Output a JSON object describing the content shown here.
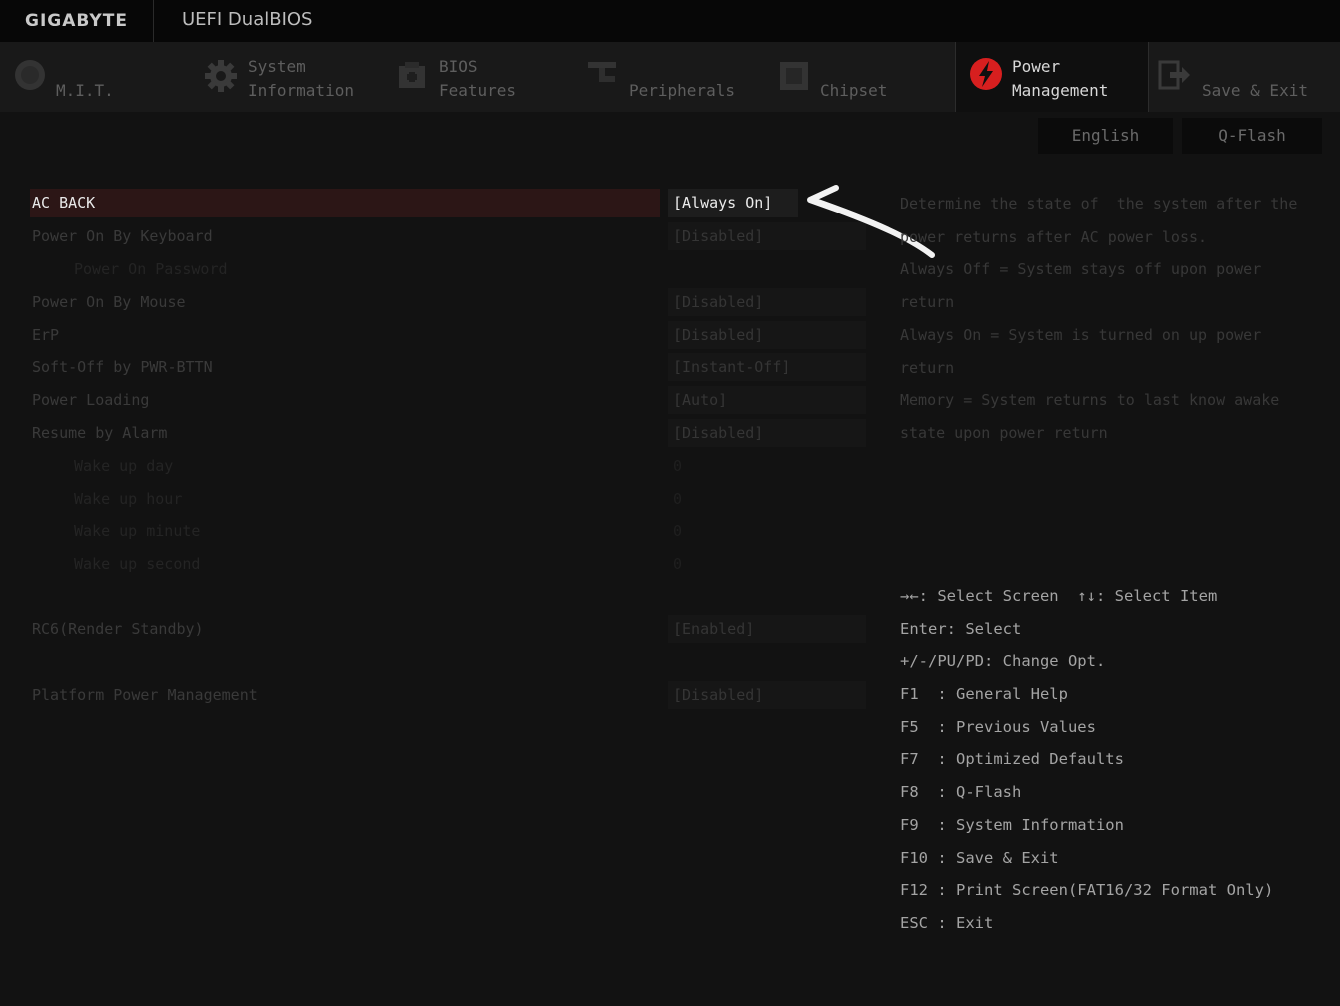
{
  "brand": "GIGABYTE",
  "product": "UEFI DualBIOS",
  "tabs": [
    {
      "line1": "",
      "line2": "M.I.T.",
      "icon": "mit-icon"
    },
    {
      "line1": "System",
      "line2": "Information",
      "icon": "gear-icon"
    },
    {
      "line1": "BIOS",
      "line2": "Features",
      "icon": "bios-features-icon"
    },
    {
      "line1": "",
      "line2": "Peripherals",
      "icon": "peripherals-icon"
    },
    {
      "line1": "",
      "line2": "Chipset",
      "icon": "chipset-icon"
    },
    {
      "line1": "Power",
      "line2": "Management",
      "icon": "power-icon"
    },
    {
      "line1": "",
      "line2": "Save & Exit",
      "icon": "exit-icon"
    }
  ],
  "active_tab": "Power Management",
  "accent_color": "#d71f1f",
  "language_button": "English",
  "qflash_button": "Q-Flash",
  "settings": [
    {
      "label": "AC BACK",
      "value": "[Always On]"
    },
    {
      "label": "Power On By Keyboard",
      "value": "[Disabled]"
    },
    {
      "label": "Power On Password",
      "value": ""
    },
    {
      "label": "Power On By Mouse",
      "value": "[Disabled]"
    },
    {
      "label": "ErP",
      "value": "[Disabled]"
    },
    {
      "label": "Soft-Off by PWR-BTTN",
      "value": "[Instant-Off]"
    },
    {
      "label": "Power Loading",
      "value": "[Auto]"
    },
    {
      "label": "Resume by Alarm",
      "value": "[Disabled]"
    },
    {
      "label": "Wake up day",
      "value": "0"
    },
    {
      "label": "Wake up hour",
      "value": "0"
    },
    {
      "label": "Wake up minute",
      "value": "0"
    },
    {
      "label": "Wake up second",
      "value": "0"
    },
    {
      "label": "RC6(Render Standby)",
      "value": "[Enabled]"
    },
    {
      "label": "Platform Power Management",
      "value": "[Disabled]"
    }
  ],
  "help_text": "Determine the state of  the system after the power returns after AC power loss.\nAlways Off = System stays off upon power return\nAlways On = System is turned on up power return\nMemory = System returns to last know awake state upon power return",
  "key_help": [
    "→←: Select Screen  ↑↓: Select Item",
    "Enter: Select",
    "+/-/PU/PD: Change Opt.",
    "F1  : General Help",
    "F5  : Previous Values",
    "F7  : Optimized Defaults",
    "F8  : Q-Flash",
    "F9  : System Information",
    "F10 : Save & Exit",
    "F12 : Print Screen(FAT16/32 Format Only)",
    "ESC : Exit"
  ]
}
